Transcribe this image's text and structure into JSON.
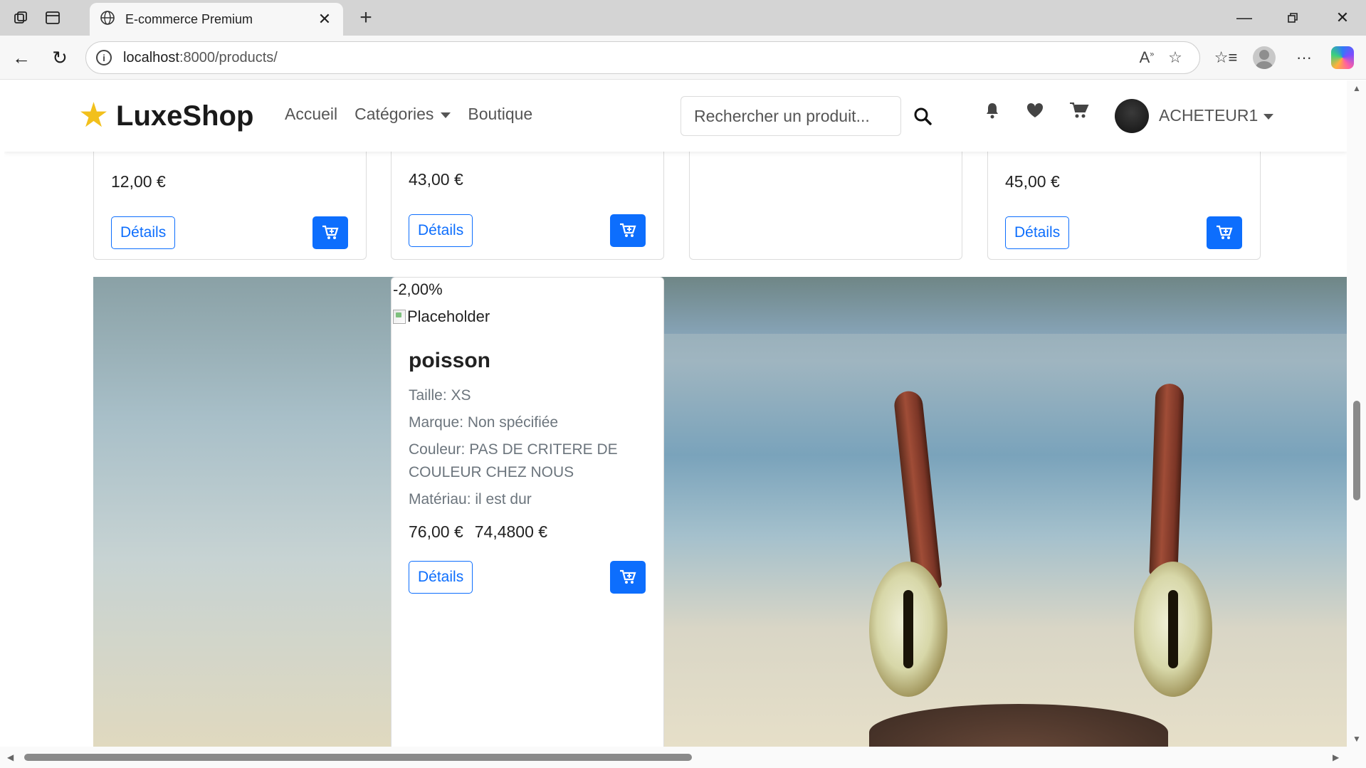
{
  "browser": {
    "tab_title": "E-commerce Premium",
    "url_host": "localhost",
    "url_rest": ":8000/products/"
  },
  "site": {
    "brand": "LuxeShop",
    "nav": {
      "home": "Accueil",
      "categories": "Catégories",
      "shop": "Boutique"
    },
    "search_placeholder": "Rechercher un produit...",
    "username": "ACHETEUR1"
  },
  "top_cards": [
    {
      "price": "12,00 €",
      "details_label": "Détails"
    },
    {
      "price": "43,00 €",
      "details_label": "Détails"
    },
    {
      "price": "",
      "details_label": ""
    },
    {
      "price": "45,00 €",
      "details_label": "Détails"
    }
  ],
  "product": {
    "discount": "-2,00%",
    "image_alt": "Placeholder",
    "title": "poisson",
    "size": "Taille: XS",
    "brand": "Marque: Non spécifiée",
    "color": "Couleur: PAS DE CRITERE DE COULEUR CHEZ NOUS",
    "material": "Matériau: il est dur",
    "old_price": "76,00 €",
    "new_price": "74,4800 €",
    "details_label": "Détails"
  },
  "colors": {
    "primary": "#0d6efd",
    "star": "#f2c01c"
  },
  "icons": [
    "tabs-icon",
    "vertical-tabs-icon",
    "globe-icon",
    "close-icon",
    "plus-icon",
    "minimize-icon",
    "restore-icon",
    "back-icon",
    "reload-icon",
    "info-icon",
    "read-aloud-icon",
    "favorite-star-icon",
    "favorites-icon",
    "profile-icon",
    "more-icon",
    "copilot-icon",
    "star-icon",
    "search-icon",
    "bell-icon",
    "heart-icon",
    "cart-icon",
    "cart-plus-icon"
  ]
}
